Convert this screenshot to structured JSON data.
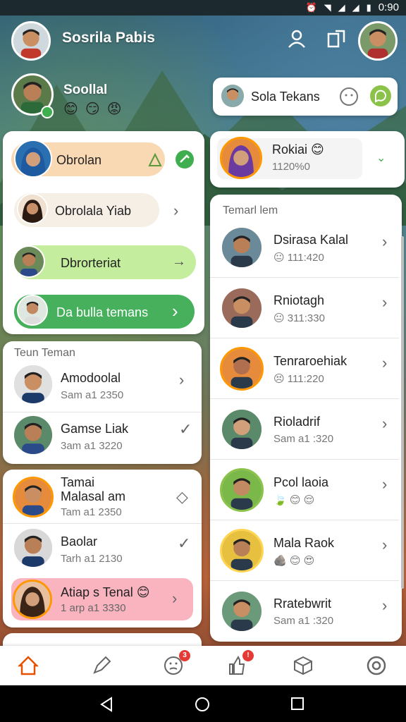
{
  "status_bar": {
    "time": "0:90"
  },
  "header": {
    "user_name": "Sosrila Pabis",
    "social_label": "Soollal",
    "social_emojis": [
      "😊",
      "😏",
      "😡"
    ]
  },
  "search_card": {
    "label": "Sola Tekans"
  },
  "left_menu": {
    "chips": [
      {
        "label": "Obrolan"
      },
      {
        "label": "Obrolala Yiab"
      },
      {
        "label": "Dbrorteriat"
      },
      {
        "label": "Da bulla temans"
      }
    ]
  },
  "right_top": {
    "name": "Rokiai 😊",
    "sub": "1120%0"
  },
  "left_section": {
    "title": "Teun Teman",
    "items": [
      {
        "name": "Amodoolal",
        "sub": "Sam a1 2350",
        "mark": "›"
      },
      {
        "name": "Gamse Liak",
        "sub": "3am a1 3220",
        "mark": "✓"
      }
    ]
  },
  "left_section2": {
    "items": [
      {
        "name": "Tamai\nMalasal am",
        "sub": "Tam a1 2350",
        "mark": "◇"
      },
      {
        "name": "Baolar",
        "sub": "Tarh a1 2130",
        "mark": "✓"
      },
      {
        "name": "Atiap s Tenal 😊",
        "sub": "1 arp a1 3330",
        "mark": "›"
      }
    ]
  },
  "right_section": {
    "title": "Temarl lem",
    "items": [
      {
        "name": "Dsirasa Kalal",
        "sub": "😐 111:420"
      },
      {
        "name": "Rniotagh",
        "sub": "😐 311:330"
      },
      {
        "name": "Tenraroehiak",
        "sub": "😣 111:220"
      },
      {
        "name": "Rioladrif",
        "sub": "Sam a1 :320"
      },
      {
        "name": "Pcol laoia",
        "sub": "🍃 😊 😌"
      },
      {
        "name": "Mala Raok",
        "sub": "🪨 😊 😍"
      },
      {
        "name": "Rratebwrit",
        "sub": "Sam a1 :320"
      }
    ]
  },
  "bottom_nav": {
    "badges": {
      "emoji": "3",
      "posts": "!"
    }
  },
  "colors": {
    "chip_peach": "#f9d9b4",
    "chip_beige": "#f5efe6",
    "chip_lightgreen": "#c4ee9d",
    "chip_green": "#46b05c",
    "highlight_pink": "#f9b4c0",
    "accent_green": "#3fae4f",
    "accent_red": "#e53935"
  }
}
